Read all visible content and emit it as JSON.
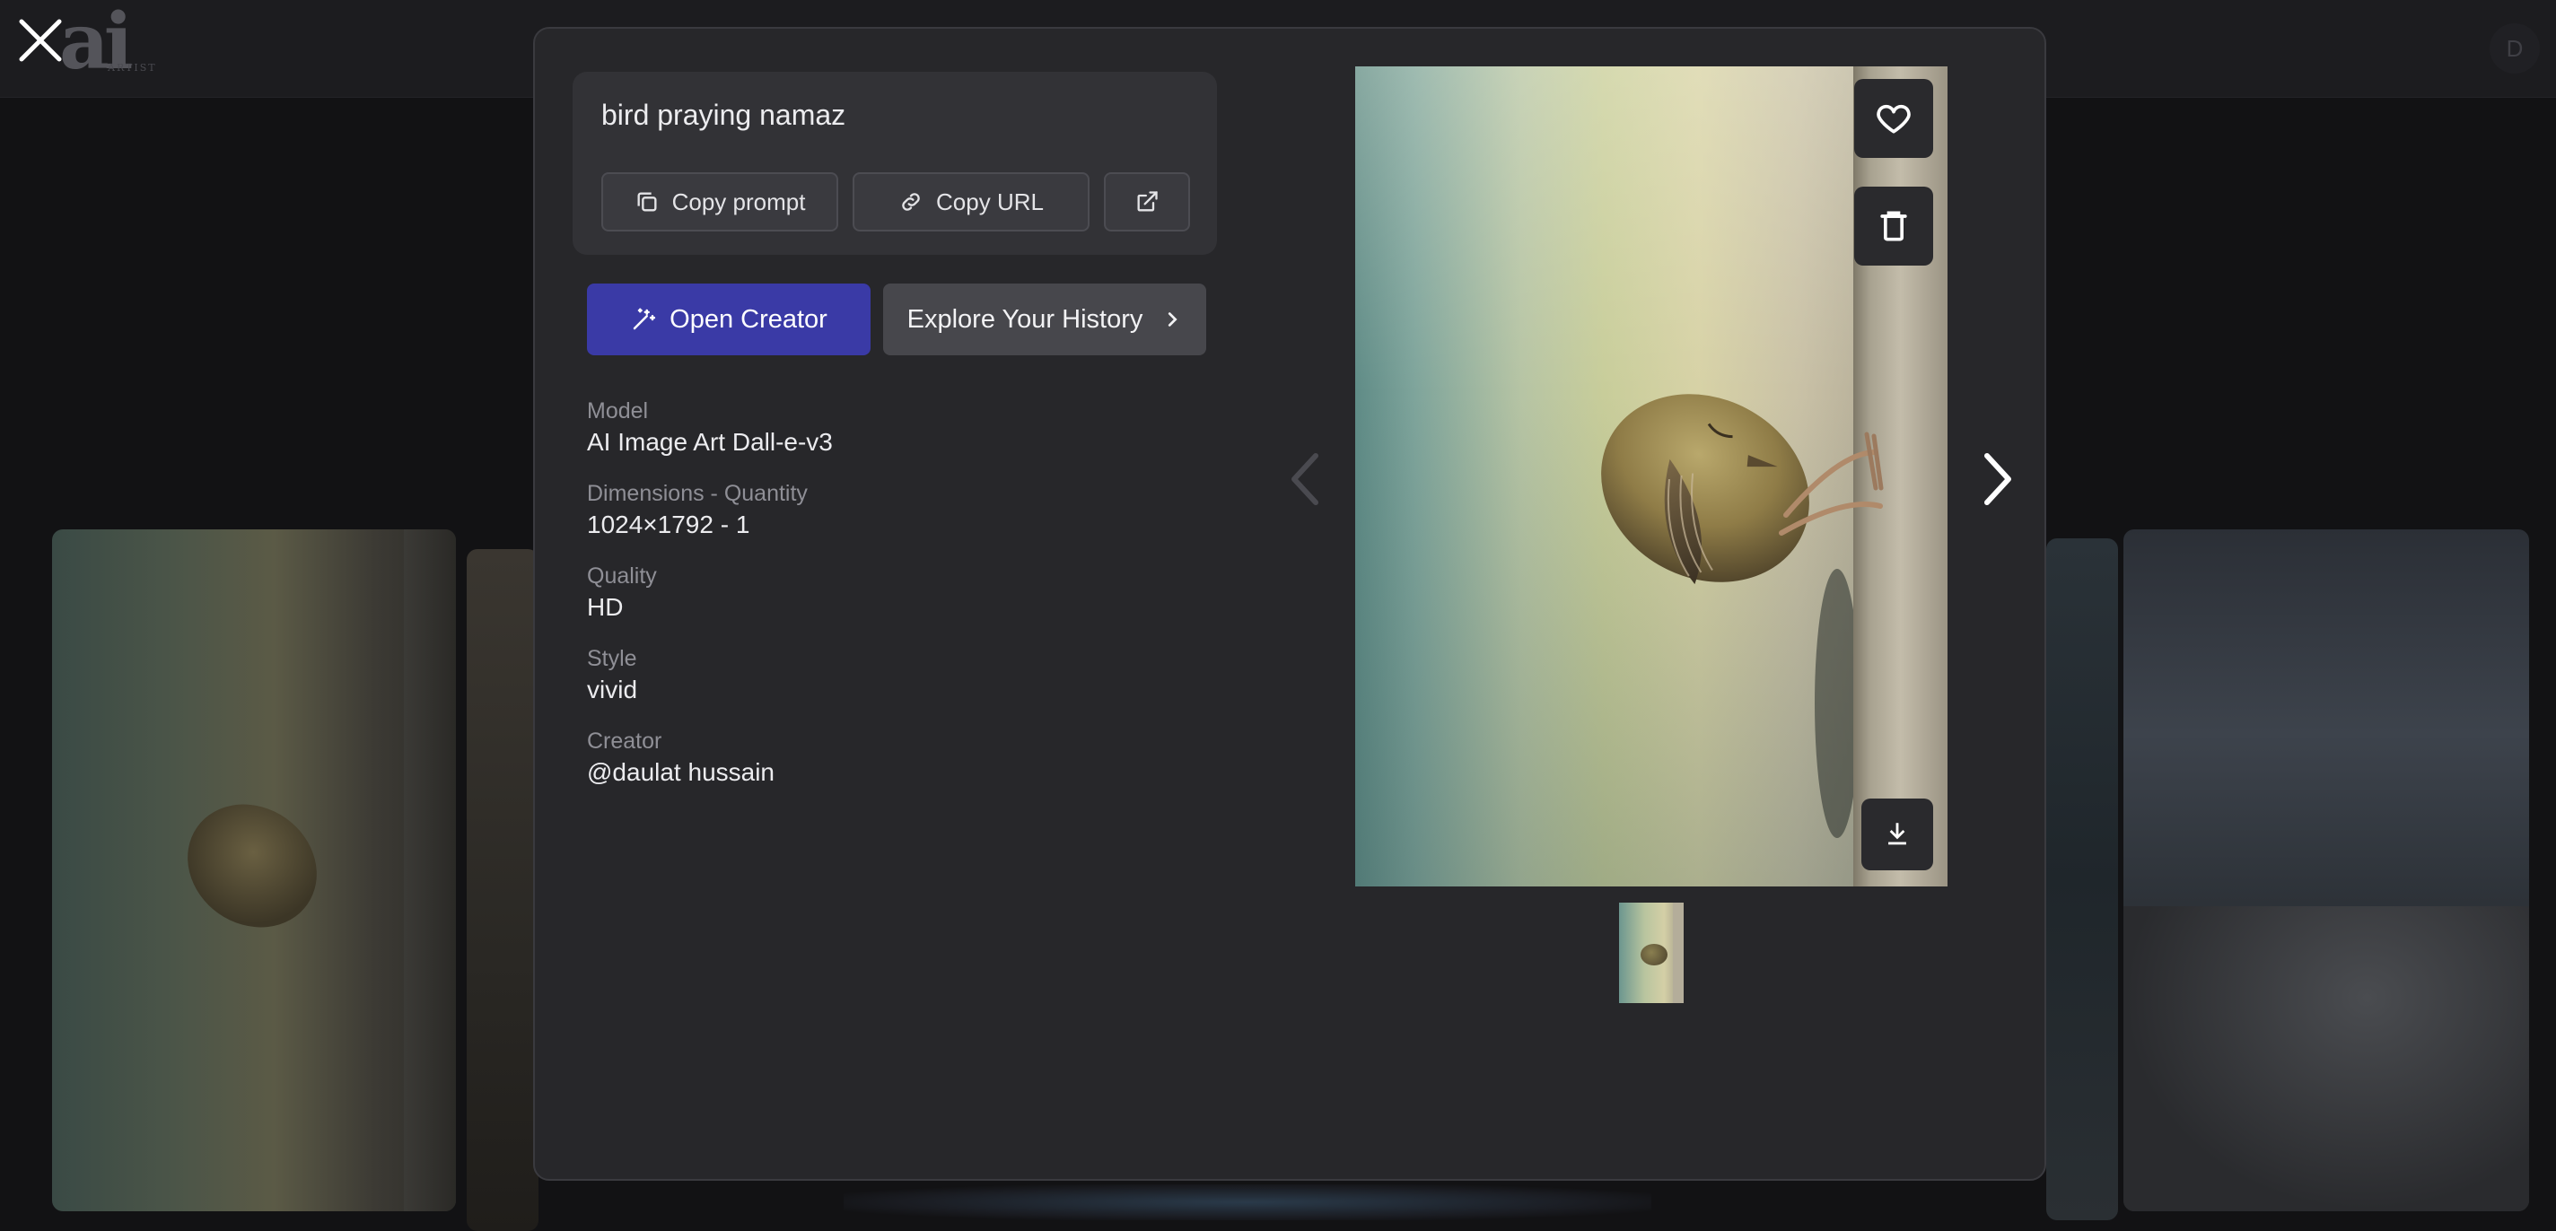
{
  "background": {
    "logo": "ai",
    "logo_caption": "ARTIST",
    "avatar_initial": "D"
  },
  "modal": {
    "prompt": "bird praying namaz",
    "buttons": {
      "copy_prompt": "Copy prompt",
      "copy_url": "Copy URL",
      "open_creator": "Open Creator",
      "explore_history": "Explore Your History"
    },
    "details": [
      {
        "label": "Model",
        "value": "AI Image Art Dall-e-v3"
      },
      {
        "label": "Dimensions - Quantity",
        "value": "1024×1792 - 1"
      },
      {
        "label": "Quality",
        "value": "HD"
      },
      {
        "label": "Style",
        "value": "vivid"
      },
      {
        "label": "Creator",
        "value": "@daulat hussain"
      }
    ]
  },
  "colors": {
    "modal_bg": "#27272a",
    "accent": "#3a3aa6",
    "page_bg": "#121214"
  },
  "icons": [
    "close-icon",
    "copy-icon",
    "link-icon",
    "external-link-icon",
    "magic-wand-icon",
    "chevron-right-icon",
    "heart-icon",
    "trash-icon",
    "download-icon",
    "chevron-left-icon"
  ]
}
